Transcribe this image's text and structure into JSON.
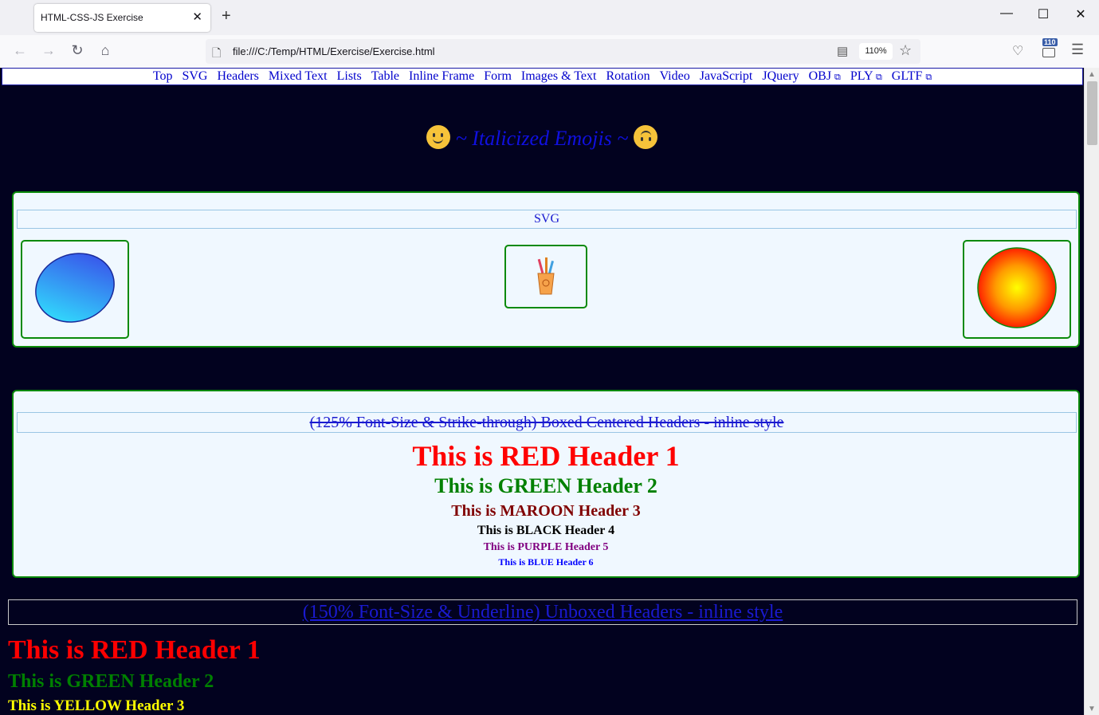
{
  "browser": {
    "tab_title": "HTML-CSS-JS Exercise",
    "url": "file:///C:/Temp/HTML/Exercise/Exercise.html",
    "zoom": "110%",
    "extension_badge": "110"
  },
  "nav": {
    "items": [
      "Top",
      "SVG",
      "Headers",
      "Mixed Text",
      "Lists",
      "Table",
      "Inline Frame",
      "Form",
      "Images & Text",
      "Rotation",
      "Video",
      "JavaScript",
      "JQuery",
      "OBJ",
      "PLY",
      "GLTF"
    ]
  },
  "emoji_title": "~ Italicized Emojis ~",
  "svg_section": {
    "title": "SVG"
  },
  "boxed": {
    "title": "(125% Font-Size & Strike-through) Boxed Centered Headers - inline style",
    "headers": [
      {
        "text": "This is RED Header 1",
        "color": "#ff0000"
      },
      {
        "text": "This is GREEN Header 2",
        "color": "#008000"
      },
      {
        "text": "This is MAROON Header 3",
        "color": "#800000"
      },
      {
        "text": "This is BLACK Header 4",
        "color": "#000000"
      },
      {
        "text": "This is PURPLE Header 5",
        "color": "#800080"
      },
      {
        "text": "This is BLUE Header 6",
        "color": "#0000ff"
      }
    ]
  },
  "unboxed": {
    "title": "(150% Font-Size & Underline) Unboxed Headers - inline style",
    "headers": [
      {
        "text": "This is RED Header 1",
        "color": "#ff0000"
      },
      {
        "text": "This is GREEN Header 2",
        "color": "#008000"
      },
      {
        "text": "This is YELLOW Header 3",
        "color": "#ffff00"
      }
    ]
  }
}
